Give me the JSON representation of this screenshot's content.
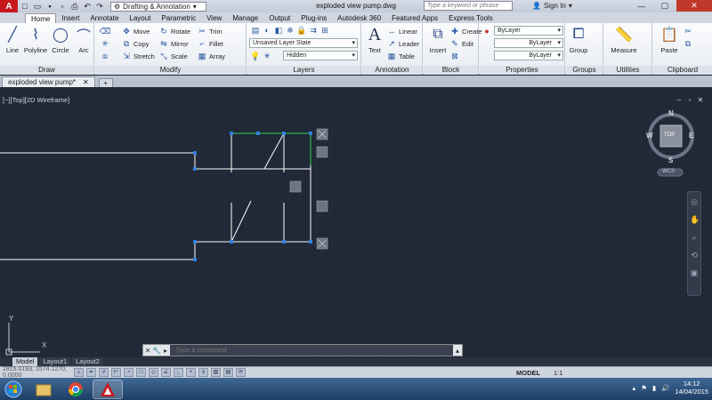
{
  "titlebar": {
    "app_logo": "A",
    "workspace": "Drafting & Annotation",
    "doc_title": "exploded view pump.dwg",
    "search_placeholder": "Type a keyword or phrase",
    "signin": "Sign In",
    "window_buttons": {
      "minimize": "—",
      "maximize": "▢",
      "close": "✕"
    }
  },
  "ribbon_tabs": [
    "Home",
    "Insert",
    "Annotate",
    "Layout",
    "Parametric",
    "View",
    "Manage",
    "Output",
    "Plug-ins",
    "Autodesk 360",
    "Featured Apps",
    "Express Tools"
  ],
  "ribbon_active_tab": "Home",
  "panels": {
    "draw": {
      "title": "Draw",
      "tools": [
        "Line",
        "Polyline",
        "Circle",
        "Arc"
      ]
    },
    "modify": {
      "title": "Modify",
      "tools": [
        [
          "Move",
          "Rotate",
          "Trim"
        ],
        [
          "Copy",
          "Mirror",
          "Fillet"
        ],
        [
          "Stretch",
          "Scale",
          "Array"
        ]
      ]
    },
    "layers": {
      "title": "Layers",
      "layer_state": "Unsaved Layer State",
      "current_layer": "Hidden"
    },
    "annotation": {
      "title": "Annotation",
      "text_label": "Text",
      "linear": "Linear",
      "leader": "Leader",
      "table": "Table"
    },
    "block": {
      "title": "Block",
      "insert": "Insert",
      "create": "Create",
      "edit": "Edit"
    },
    "properties": {
      "title": "Properties",
      "color": "ByLayer",
      "linetype": "ByLayer",
      "lineweight": "ByLayer"
    },
    "groups": {
      "title": "Groups",
      "group": "Group"
    },
    "utilities": {
      "title": "Utilities",
      "measure": "Measure"
    },
    "clipboard": {
      "title": "Clipboard",
      "paste": "Paste"
    }
  },
  "file_tab": {
    "label": "exploded view pump*",
    "close": "✕",
    "new": "+"
  },
  "viewport": {
    "label": "[−][Top][2D Wireframe]",
    "viewcube": {
      "north": "N",
      "south": "S",
      "east": "E",
      "west": "W",
      "face": "TOP",
      "wcs": "WCS"
    },
    "ucs": {
      "y": "Y",
      "x": "X"
    }
  },
  "layout_tabs": [
    "Model",
    "Layout1",
    "Layout2"
  ],
  "active_layout": "Model",
  "command_line": {
    "placeholder": "Type a command"
  },
  "statusbar": {
    "coords": "2815.0193, 1574.1270, 0.0000",
    "model": "MODEL",
    "scale": "1:1"
  },
  "taskbar": {
    "time": "14:12",
    "date": "14/04/2015"
  },
  "colors": {
    "accent_red": "#c8181e",
    "canvas": "#212836",
    "grip_blue": "#2f7fe0",
    "selection_green": "#2bb24c"
  }
}
